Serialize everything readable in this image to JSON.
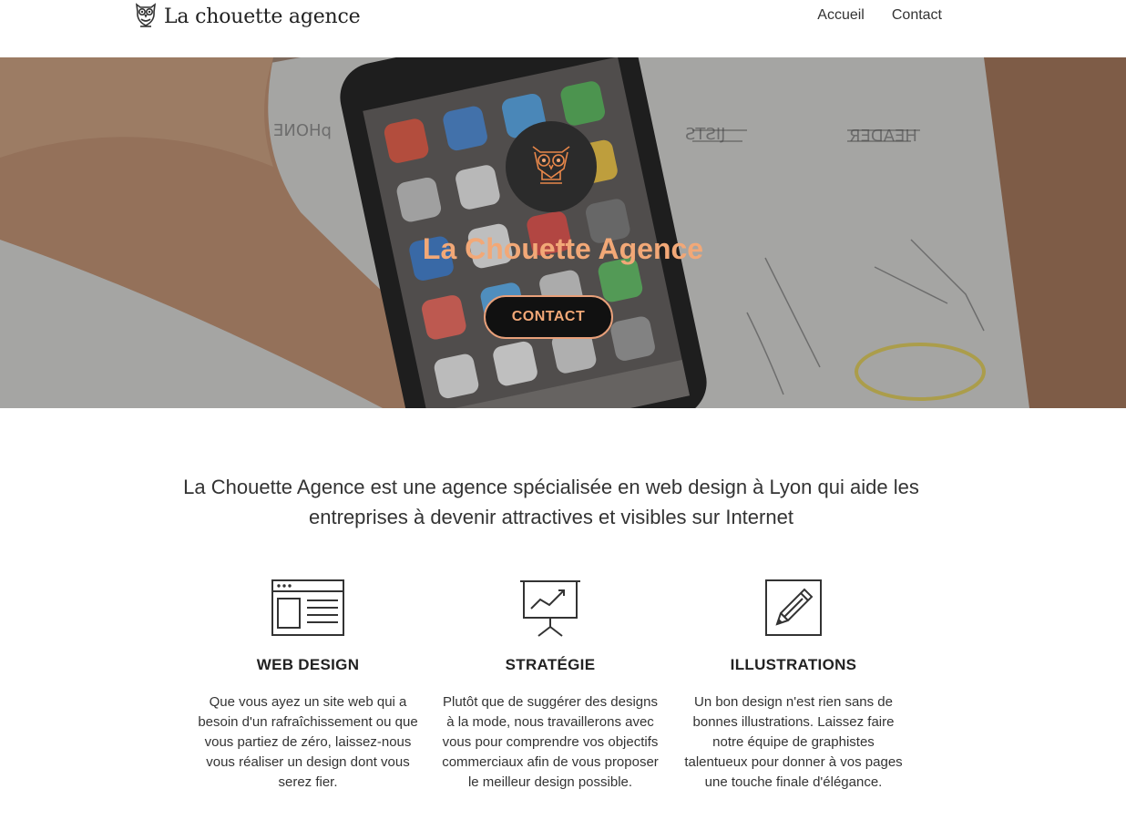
{
  "header": {
    "logo_text": "La chouette agence",
    "nav": [
      "Accueil",
      "Contact"
    ]
  },
  "hero": {
    "title": "La Chouette Agence",
    "button": "CONTACT"
  },
  "intro": {
    "text": "La Chouette Agence est une agence spécialisée en web design à Lyon qui aide les entreprises à devenir attractives et visibles sur Internet"
  },
  "services": [
    {
      "icon": "browser-icon",
      "title": "WEB DESIGN",
      "text": "Que vous ayez un site web qui a besoin d'un rafraîchissement ou que vous partiez de zéro, laissez-nous vous réaliser un design dont vous serez fier."
    },
    {
      "icon": "presentation-chart-icon",
      "title": "STRATÉGIE",
      "text": "Plutôt que de suggérer des designs à la mode, nous travaillerons avec vous pour comprendre vos objectifs commerciaux afin de vous proposer le meilleur design possible."
    },
    {
      "icon": "pencil-icon",
      "title": "ILLUSTRATIONS",
      "text": "Un bon design n'est rien sans de bonnes illustrations. Laissez faire notre équipe de graphistes talentueux pour donner à vos pages une touche finale d'élégance."
    }
  ],
  "colors": {
    "accent": "#f2a877",
    "button_border": "#e8a07a",
    "badge": "#2b2b2b"
  }
}
